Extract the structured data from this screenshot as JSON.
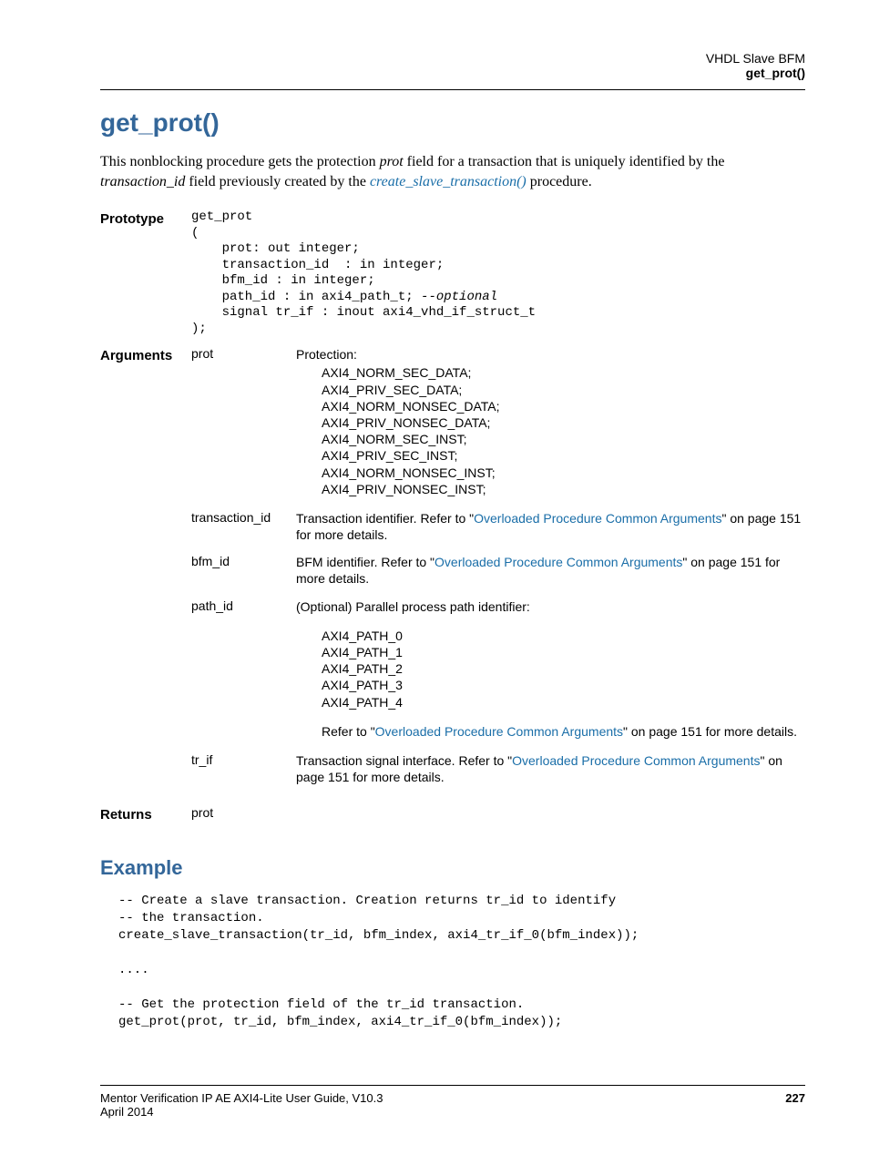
{
  "header": {
    "line1": "VHDL Slave BFM",
    "line2": "get_prot()"
  },
  "title": "get_prot()",
  "intro": {
    "t1": "This nonblocking procedure gets the protection ",
    "i1": "prot",
    "t2": " field for a transaction that is uniquely identified by the ",
    "i2": "transaction_id",
    "t3": " field previously created by the ",
    "link": "create_slave_transaction()",
    "t4": " procedure."
  },
  "proto_label": "Prototype",
  "proto": {
    "l1": "get_prot",
    "l2": "(",
    "l3": "    prot: out integer;",
    "l4": "    transaction_id  : in integer;",
    "l5": "    bfm_id : in integer;",
    "l6a": "    path_id : in axi4_path_t; ",
    "l6b": "--optional",
    "l7": "    signal tr_if : inout axi4_vhd_if_struct_t",
    "l8": ");"
  },
  "args_label": "Arguments",
  "args": {
    "prot": {
      "name": "prot",
      "desc_header": "Protection:",
      "values": [
        "AXI4_NORM_SEC_DATA;",
        "AXI4_PRIV_SEC_DATA;",
        "AXI4_NORM_NONSEC_DATA;",
        "AXI4_PRIV_NONSEC_DATA;",
        "AXI4_NORM_SEC_INST;",
        "AXI4_PRIV_SEC_INST;",
        "AXI4_NORM_NONSEC_INST;",
        "AXI4_PRIV_NONSEC_INST;"
      ]
    },
    "transaction_id": {
      "name": "transaction_id",
      "t1": "Transaction identifier. Refer to \"",
      "link": "Overloaded Procedure Common Arguments",
      "t2": "\" on page 151 for more details."
    },
    "bfm_id": {
      "name": "bfm_id",
      "t1": "BFM identifier. Refer to \"",
      "link": "Overloaded Procedure Common Arguments",
      "t2": "\" on page 151 for more details."
    },
    "path_id": {
      "name": "path_id",
      "desc_header": "(Optional) Parallel process path identifier:",
      "values": [
        "AXI4_PATH_0",
        "AXI4_PATH_1",
        "AXI4_PATH_2",
        "AXI4_PATH_3",
        "AXI4_PATH_4"
      ],
      "refer_t1": "Refer to \"",
      "refer_link": "Overloaded Procedure Common Arguments",
      "refer_t2": "\" on page 151 for more details."
    },
    "tr_if": {
      "name": "tr_if",
      "t1": "Transaction signal interface. Refer to \"",
      "link": "Overloaded Procedure Common Arguments",
      "t2": "\" on page 151 for more details."
    }
  },
  "returns_label": "Returns",
  "returns_value": "prot",
  "example_title": "Example",
  "example_code": "-- Create a slave transaction. Creation returns tr_id to identify\n-- the transaction.\ncreate_slave_transaction(tr_id, bfm_index, axi4_tr_if_0(bfm_index));\n\n....\n\n-- Get the protection field of the tr_id transaction.\nget_prot(prot, tr_id, bfm_index, axi4_tr_if_0(bfm_index));",
  "footer": {
    "left": "Mentor Verification IP AE AXI4-Lite User Guide, V10.3",
    "page": "227",
    "date": "April 2014"
  }
}
